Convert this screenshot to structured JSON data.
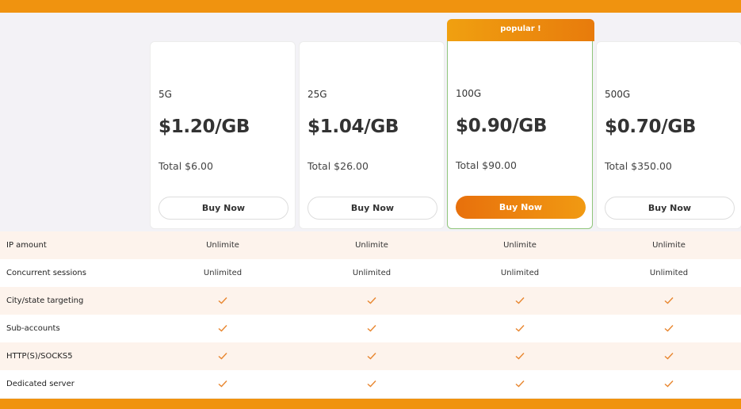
{
  "popular_tag": "popular !",
  "plans": [
    {
      "name": "5G",
      "price": "$1.20/GB",
      "total": "Total $6.00",
      "button": "Buy Now"
    },
    {
      "name": "25G",
      "price": "$1.04/GB",
      "total": "Total $26.00",
      "button": "Buy Now"
    },
    {
      "name": "100G",
      "price": "$0.90/GB",
      "total": "Total $90.00",
      "button": "Buy Now"
    },
    {
      "name": "500G",
      "price": "$0.70/GB",
      "total": "Total $350.00",
      "button": "Buy Now"
    }
  ],
  "features": [
    {
      "label": "IP amount",
      "values": [
        "Unlimite",
        "Unlimite",
        "Unlimite",
        "Unlimite"
      ]
    },
    {
      "label": "Concurrent sessions",
      "values": [
        "Unlimited",
        "Unlimited",
        "Unlimited",
        "Unlimited"
      ]
    },
    {
      "label": "City/state targeting",
      "check": true
    },
    {
      "label": "Sub-accounts",
      "check": true
    },
    {
      "label": "HTTP(S)/SOCKS5",
      "check": true
    },
    {
      "label": "Dedicated server",
      "check": true
    }
  ],
  "colors": {
    "accent": "#f0930f",
    "check": "#e8862f",
    "popular_border": "#8fc57a"
  },
  "icons": {
    "included": "check-icon"
  }
}
